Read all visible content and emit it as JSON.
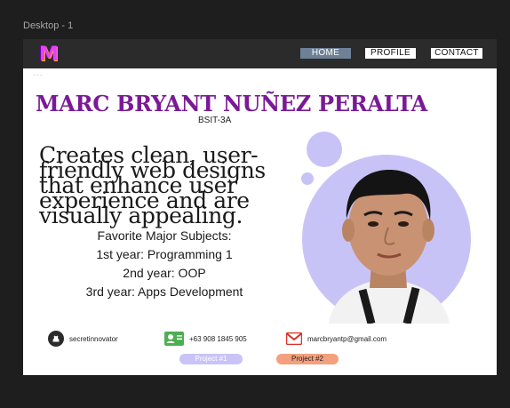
{
  "frame_label": "Desktop - 1",
  "nav": {
    "logo": "M",
    "home": "HOME",
    "profile": "PROFILE",
    "contact": "CONTACT"
  },
  "dots": "- - -",
  "hero": {
    "name": "MARC BRYANT NUÑEZ PERALTA",
    "section": "BSIT-3A",
    "tagline": "Creates clean, user-friendly web designs that enhance user experience and are visually appealing.",
    "subjects_title": "Favorite Major Subjects:",
    "subjects": [
      "1st year: Programming 1",
      "2nd year: OOP",
      "3rd year: Apps Development"
    ]
  },
  "contacts": {
    "github": "secretinnovator",
    "phone": "+63 908 1845 905",
    "email": "marcbryantp@gmail.com"
  },
  "projects": {
    "p1": "Project #1",
    "p2": "Project #2"
  },
  "icons": [
    "logo-m-icon",
    "github-icon",
    "contact-card-icon",
    "mail-icon"
  ],
  "colors": {
    "name": "#7a1a96",
    "accent_circle": "#c8c3f7",
    "nav_active": "#6f8197",
    "project2": "#f4a07e"
  }
}
